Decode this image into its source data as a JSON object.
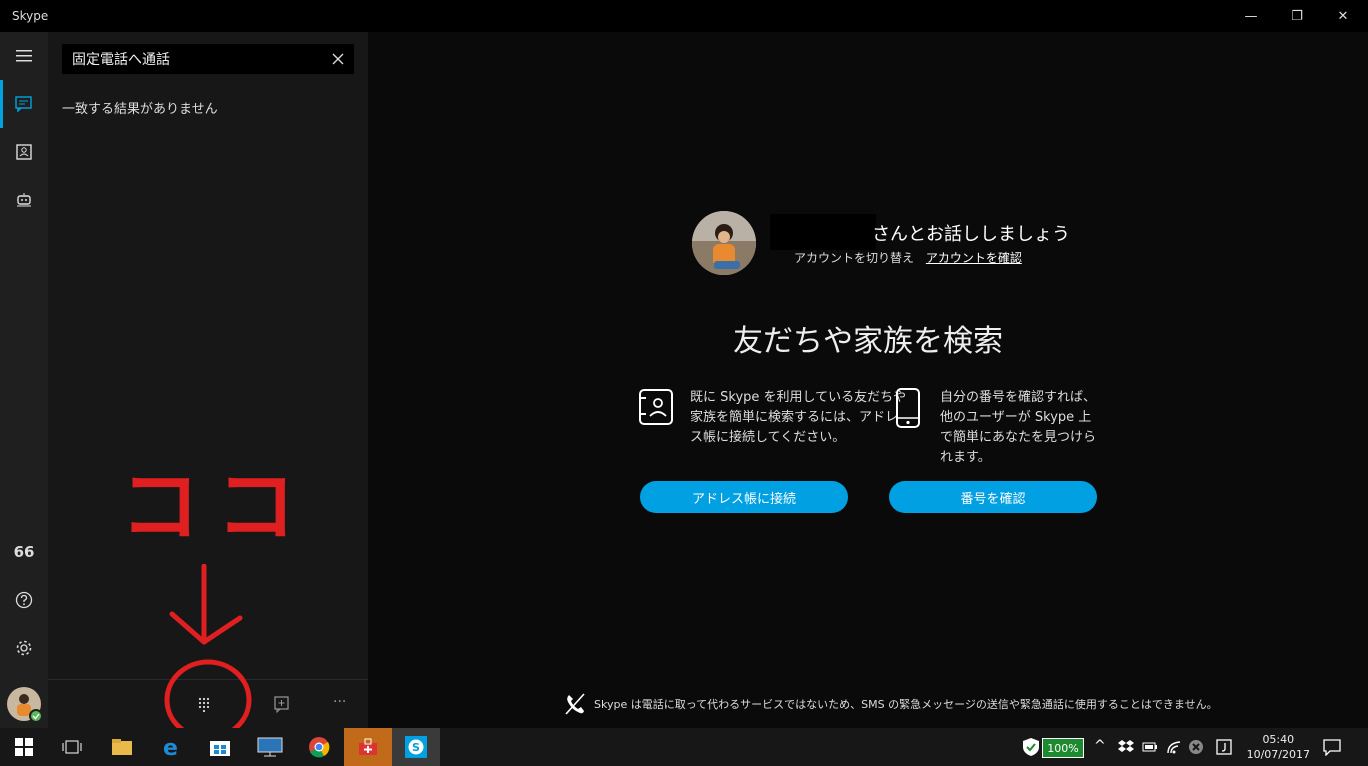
{
  "window": {
    "title": "Skype",
    "minimize": "—",
    "maximize": "❐",
    "close": "✕"
  },
  "sidebar": {
    "search": {
      "value": "固定電話へ通話"
    },
    "no_results": "一致する結果がありません",
    "rail_quote": "66"
  },
  "main": {
    "greeting": "さんとお話ししましょう",
    "switch_account": "アカウントを切り替え",
    "verify_account": "アカウントを確認",
    "heading": "友だちや家族を検索",
    "feature_left": "既に Skype を利用している友だちや家族を簡単に検索するには、アドレス帳に接続してください。",
    "feature_right": "自分の番号を確認すれば、他のユーザーが Skype 上で簡単にあなたを見つけられます。",
    "btn_address_book": "アドレス帳に接続",
    "btn_verify_number": "番号を確認",
    "disclaimer": "Skype は電話に取って代わるサービスではないため、SMS の緊急メッセージの送信や緊急通話に使用することはできません。"
  },
  "panel_bottom": {
    "more": "···"
  },
  "taskbar": {
    "battery": "100%",
    "time": "05:40",
    "date": "10/07/2017"
  },
  "annotation": {
    "text": "ココ",
    "color": "#e02020"
  },
  "colors": {
    "accent": "#00a3e0",
    "button": "#00a0e3"
  }
}
